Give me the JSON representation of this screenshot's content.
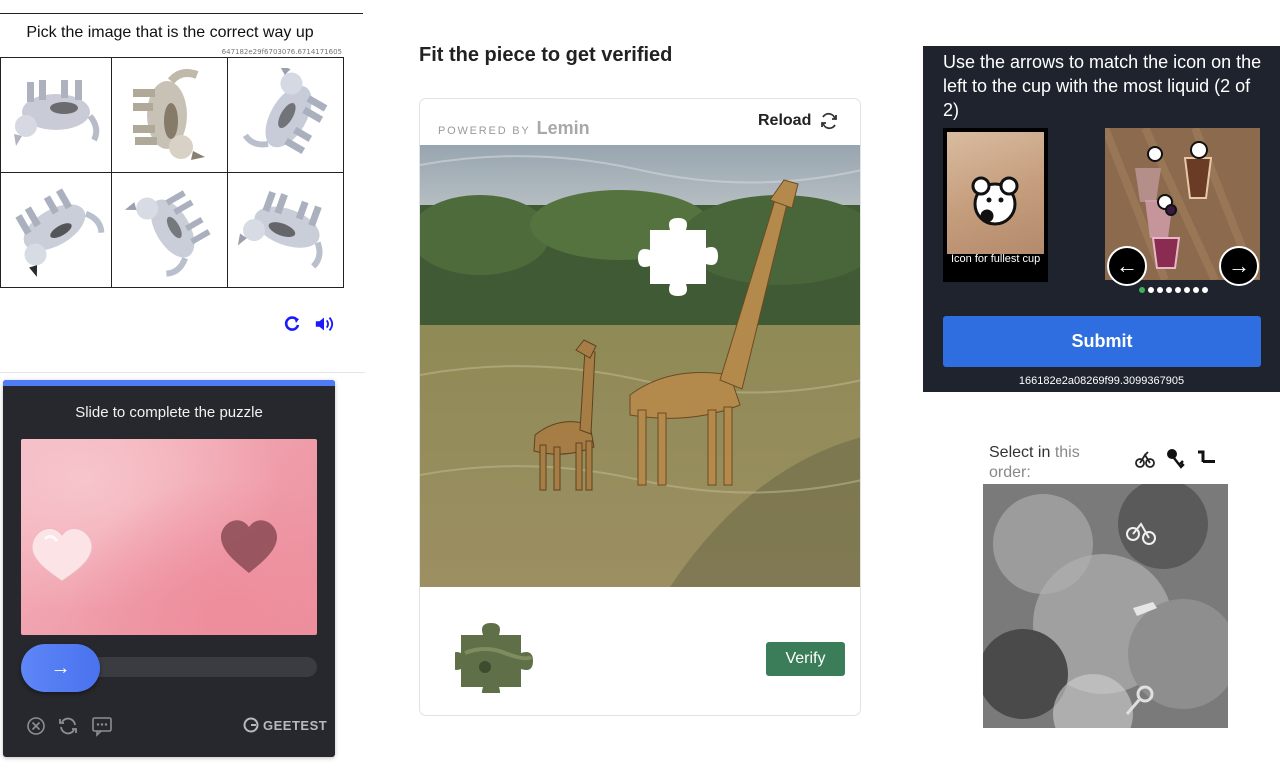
{
  "orientation_captcha": {
    "title": "Pick the image that is the correct way up",
    "challenge_id": "647182e29f6703076.6714171605",
    "tiles": [
      "dog-upside-down",
      "dog-upright-sideways",
      "dog-rotated",
      "dog-rotated",
      "dog-rotated",
      "dog-rotated"
    ],
    "refresh_icon": "refresh-icon",
    "audio_icon": "audio-icon",
    "accent_color": "#1a1aff"
  },
  "geetest": {
    "title": "Slide to complete the puzzle",
    "slider_arrow": "→",
    "brand": "GEETEST",
    "accent_color": "#4f7cf5"
  },
  "lemin": {
    "heading": "Fit the piece to get verified",
    "powered_by": "POWERED BY",
    "brand": "Lemin",
    "reload_label": "Reload",
    "verify_label": "Verify",
    "verify_color": "#3a7d58"
  },
  "cup_captcha": {
    "prompt": "Use the arrows to match the icon on the left to the cup with the most liquid (2 of 2)",
    "reference_caption": "Icon for fullest cup",
    "prev_arrow": "←",
    "next_arrow": "→",
    "page_count": 8,
    "active_page": 1,
    "submit_label": "Submit",
    "challenge_id": "166182e2a08269f99.3099367905",
    "submit_color": "#2f6ee0"
  },
  "order_captcha": {
    "prompt_main": "Select in",
    "prompt_faint": "this",
    "prompt_line2": "order:",
    "order_icons": [
      "bicycle-icon",
      "key-icon",
      "axe-icon"
    ]
  }
}
